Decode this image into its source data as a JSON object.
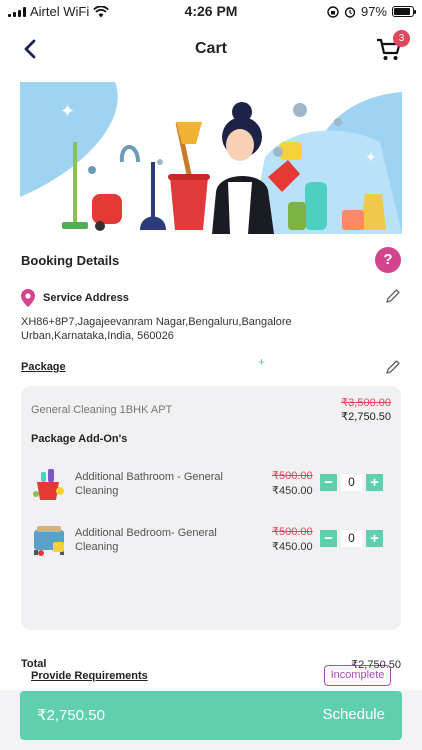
{
  "status": {
    "carrier": "Airtel WiFi",
    "time": "4:26 PM",
    "battery": "97%",
    "battery_level": 0.97
  },
  "header": {
    "title": "Cart",
    "cart_count": "3"
  },
  "booking": {
    "title": "Booking Details",
    "help": "?",
    "address_label": "Service Address",
    "address": "XH86+8P7,Jagajeevanram Nagar,Bengaluru,Bangalore Urban,Karnataka,India, 560026"
  },
  "package": {
    "label": "Package",
    "name": "General Cleaning 1BHK APT",
    "old_price": "₹3,500.00",
    "new_price": "₹2,750.50",
    "addons_title": "Package Add-On's",
    "addons": [
      {
        "name": "Additional Bathroom - General Cleaning",
        "old_price": "₹500.00",
        "new_price": "₹450.00",
        "qty": "0",
        "minus": "−",
        "plus": "+"
      },
      {
        "name": "Additional Bedroom- General Cleaning",
        "old_price": "₹500.00",
        "new_price": "₹450.00",
        "qty": "0",
        "minus": "−",
        "plus": "+"
      }
    ],
    "requirements_label": "Provide Requirements",
    "requirements_status": "Incomplete"
  },
  "total": {
    "label": "Total",
    "value": "₹2,750.50"
  },
  "footer": {
    "amount": "₹2,750.50",
    "action": "Schedule"
  },
  "colors": {
    "accent": "#5fcfae",
    "strike": "#e0475a",
    "help": "#d4458f",
    "status_badge": "#a64db8"
  },
  "icons": [
    "back-arrow-icon",
    "cart-icon",
    "help-icon",
    "location-pin-icon",
    "pencil-icon",
    "wifi-icon",
    "alarm-icon",
    "battery-icon"
  ]
}
